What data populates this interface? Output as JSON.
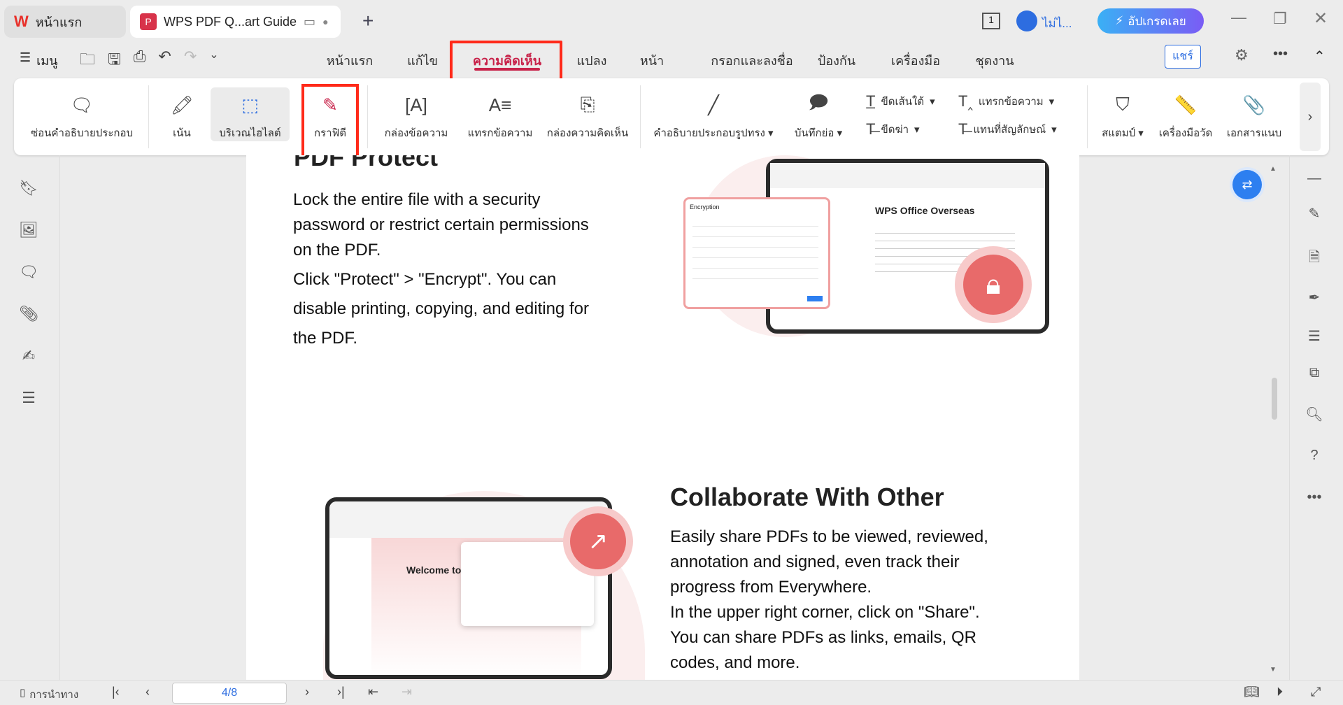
{
  "tabs": [
    {
      "label": "หน้าแรก",
      "icon": "wps-logo-icon"
    },
    {
      "label": "WPS PDF Q...art Guide",
      "icon": "pdf-icon"
    }
  ],
  "titlebar": {
    "page_badge": "1",
    "user": "ไม่ไ...",
    "upgrade": "อัปเกรดเลย"
  },
  "toolbar": {
    "menu": "เมนู",
    "share": "แชร์"
  },
  "menu_tabs": [
    "หน้าแรก",
    "แก้ไข",
    "ความคิดเห็น",
    "แปลง",
    "หน้า",
    "กรอกและลงชื่อ",
    "ป้องกัน",
    "เครื่องมือ",
    "ชุดงาน"
  ],
  "active_tab": "ความคิดเห็น",
  "ribbon": {
    "hide": "ซ่อนคำอธิบายประกอบ",
    "highlight": "เน้น",
    "area_highlight": "บริเวณไฮไลต์",
    "graffiti": "กราฟิตี",
    "textbox": "กล่องข้อความ",
    "insert_text": "แทรกข้อความ",
    "comment_box": "กล่องความคิดเห็น",
    "shape": "คำอธิบายประกอบรูปทรง",
    "note": "บันทึกย่อ",
    "underline": "ขีดเส้นใต้",
    "strike": "ขีดฆ่า",
    "insert_text2": "แทรกข้อความ",
    "replace": "แทนที่สัญลักษณ์",
    "stamp": "สแตมป์",
    "measure": "เครื่องมือวัด",
    "attach": "เอกสารแนบ"
  },
  "document": {
    "heading1": "PDF Protect",
    "para1": [
      "Lock the entire file with a security",
      "password or restrict certain permissions",
      "on the PDF.",
      "Click \"Protect\" > \"Encrypt\". You can",
      "disable printing, copying, and editing for",
      " the PDF."
    ],
    "img1": {
      "dialog_title": "Encryption",
      "doc_title": "WPS Office Overseas"
    },
    "heading2": "Collaborate With Other",
    "para2": [
      "Easily share PDFs to be viewed, reviewed,",
      "annotation and signed, even track their",
      "progress from Everywhere.",
      "In the upper right corner, click on \"Share\".",
      "You can share PDFs as links, emails, QR",
      "codes, and more."
    ],
    "img2": {
      "welcome": "Welcome to"
    }
  },
  "statusbar": {
    "nav": "การนำทาง",
    "page": "4/8"
  },
  "colors": {
    "accent": "#c8234a",
    "highlight_box": "#ff2a1a",
    "upgrade": "#3d8cf7"
  }
}
